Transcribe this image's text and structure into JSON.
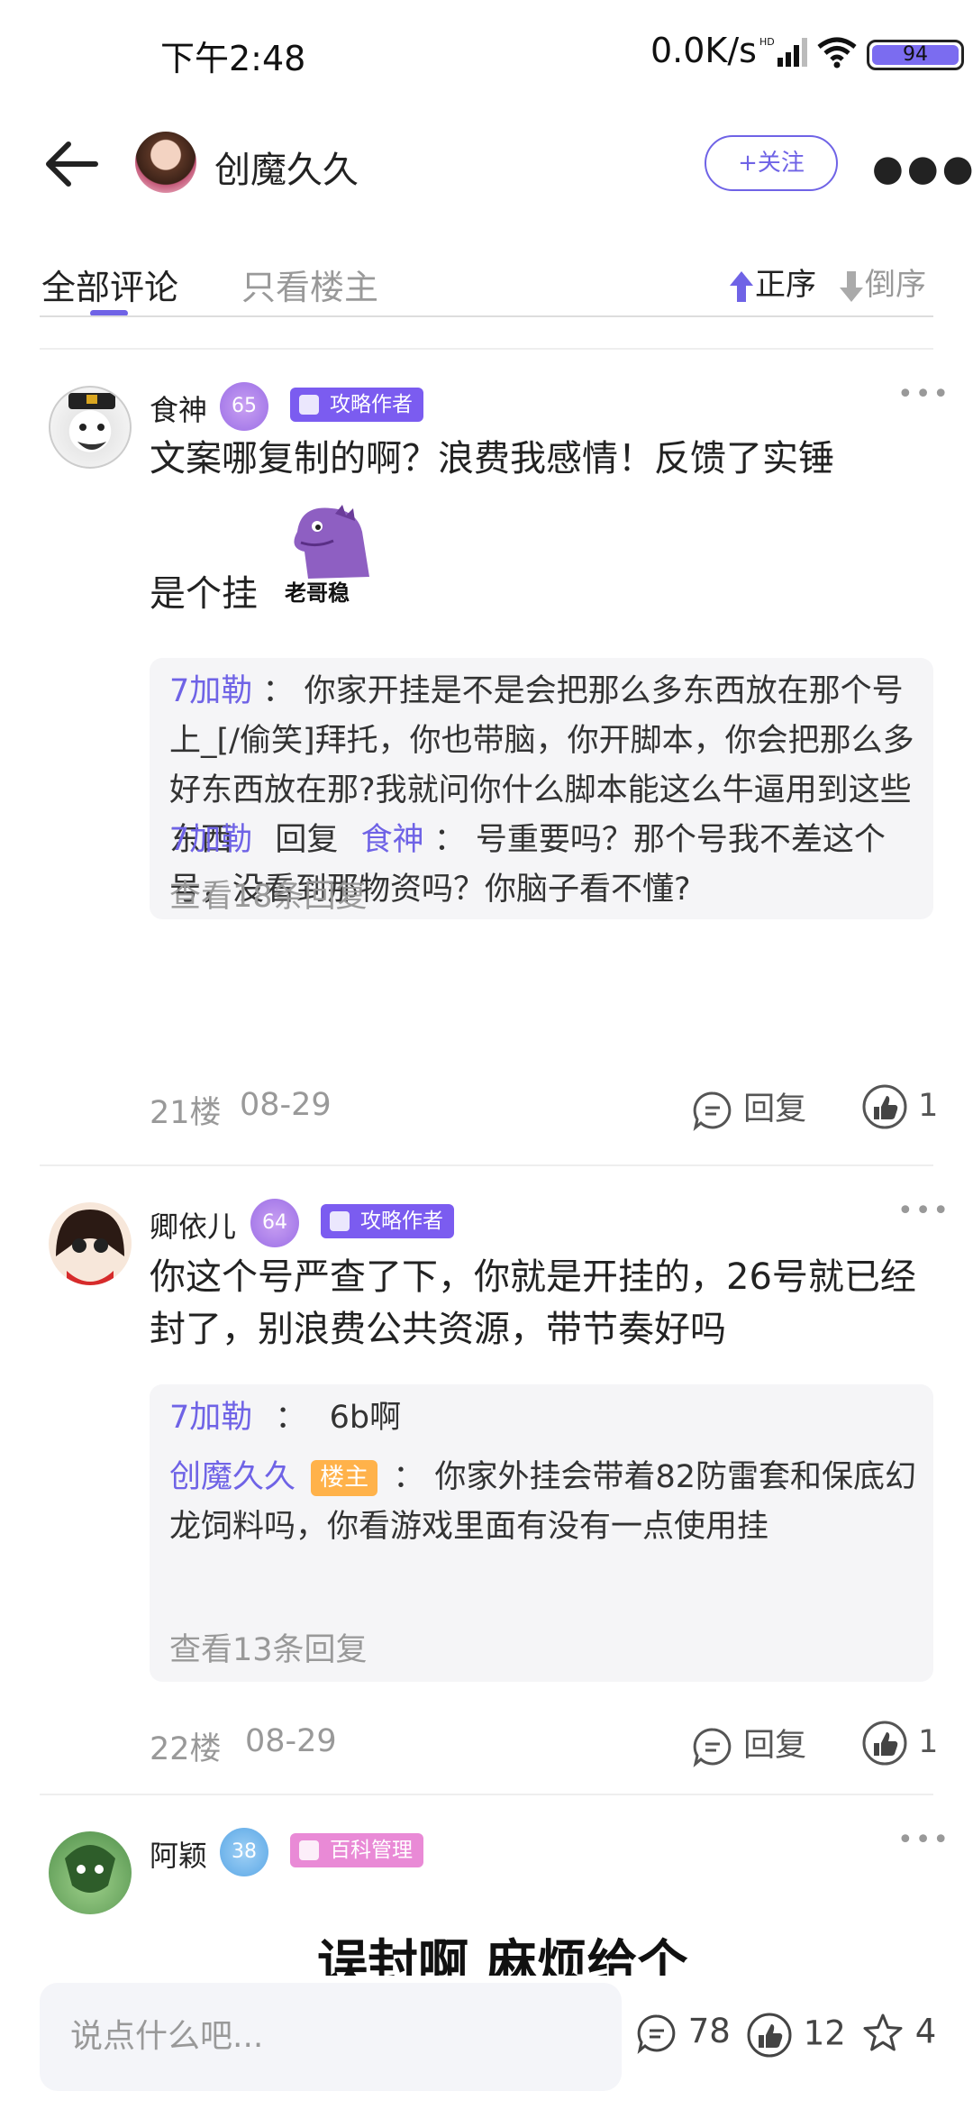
{
  "status": {
    "time": "下午2:48",
    "speed": "0.0K/s",
    "battery": "94"
  },
  "header": {
    "name": "创魔久久",
    "follow_label": "+关注"
  },
  "tabs": {
    "all": "全部评论",
    "op_only": "只看楼主",
    "asc": "正序",
    "desc": "倒序"
  },
  "comments": [
    {
      "name": "食神",
      "level": "65",
      "badge": "攻略作者",
      "text_line1": "文案哪复制的啊？浪费我感情！反馈了实锤",
      "text_line2": "是个挂",
      "sticker_text": "老哥稳",
      "replies": [
        {
          "user": "7加勒",
          "sep": "：",
          "text": "你家开挂是不是会把那么多东西放在那个号上_[/偷笑]拜托，你也带脑，你开脚本，你会把那么多好东西放在那?我就问你什么脚本能这么牛逼用到这些东西"
        },
        {
          "user": "7加勒",
          "mid": "回复",
          "target": "食神",
          "sep": "：",
          "text": "号重要吗？那个号我不差这个号，没看到那物资吗？你脑子看不懂?"
        }
      ],
      "more": "查看18条回复",
      "floor": "21楼",
      "date": "08-29",
      "reply_label": "回复",
      "likes": "1"
    },
    {
      "name": "卿依儿",
      "level": "64",
      "badge": "攻略作者",
      "text": "你这个号严查了下，你就是开挂的，26号就已经封了，别浪费公共资源，带节奏好吗",
      "replies": [
        {
          "user": "7加勒",
          "sep": "：",
          "text": "6b啊"
        },
        {
          "user": "创魔久久",
          "tag": "楼主",
          "sep": "：",
          "text": "你家外挂会带着82防雷套和保底幻龙饲料吗，你看游戏里面有没有一点使用挂"
        }
      ],
      "more": "查看13条回复",
      "floor": "22楼",
      "date": "08-29",
      "reply_label": "回复",
      "likes": "1"
    },
    {
      "name": "阿颖",
      "level": "38",
      "badge": "百科管理",
      "text": "误封啊 麻烦给个"
    }
  ],
  "bottom": {
    "placeholder": "说点什么吧...",
    "comments": "78",
    "likes": "12",
    "stars": "4"
  },
  "colors": {
    "accent": "#6f63e6",
    "host_tag": "#ffb24a",
    "badge": "#7b5cf0",
    "badge_pink": "#e98ad6"
  }
}
